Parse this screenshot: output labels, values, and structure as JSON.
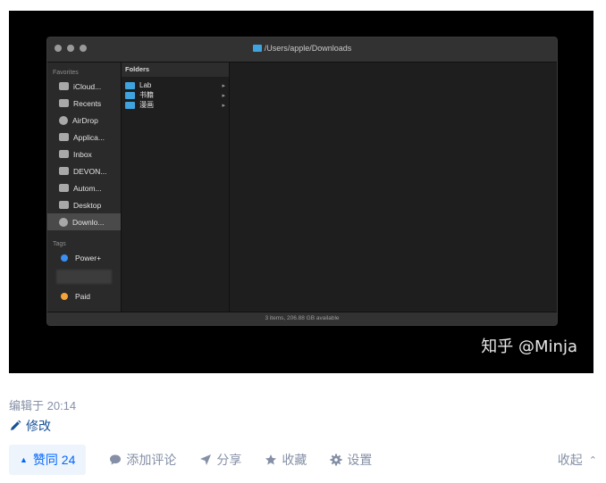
{
  "finder": {
    "path": "/Users/apple/Downloads",
    "sidebar_favorites_header": "Favorites",
    "favorites": [
      {
        "label": "iCloud...",
        "icon": "cloud-icon"
      },
      {
        "label": "Recents",
        "icon": "clock-icon"
      },
      {
        "label": "AirDrop",
        "icon": "airdrop-icon"
      },
      {
        "label": "Applica...",
        "icon": "applications-icon"
      },
      {
        "label": "Inbox",
        "icon": "folder-icon"
      },
      {
        "label": "DEVON...",
        "icon": "folder-icon"
      },
      {
        "label": "Autom...",
        "icon": "folder-icon"
      },
      {
        "label": "Desktop",
        "icon": "desktop-icon"
      },
      {
        "label": "Downlo...",
        "icon": "download-icon",
        "active": true
      }
    ],
    "sidebar_tags_header": "Tags",
    "tags": [
      {
        "label": "Power+",
        "color": "#3b8ff0"
      },
      {
        "label": "Paid",
        "color": "#f3a43b"
      }
    ],
    "column_header": "Folders",
    "column_items": [
      {
        "label": "Lab"
      },
      {
        "label": "书籍"
      },
      {
        "label": "漫画"
      }
    ],
    "status": "3 items, 206.88 GB available"
  },
  "watermark": "知乎 @Minja",
  "meta": {
    "edited": "编辑于 20:14",
    "edit_link": "修改"
  },
  "actions": {
    "vote": "赞同 24",
    "comment": "添加评论",
    "share": "分享",
    "favorite": "收藏",
    "settings": "设置",
    "collapse": "收起"
  },
  "colors": {
    "link": "#175199",
    "vote_bg": "#eef4fc",
    "vote_text": "#0066ff",
    "muted": "#8590a6",
    "folder": "#3fa3dd"
  }
}
